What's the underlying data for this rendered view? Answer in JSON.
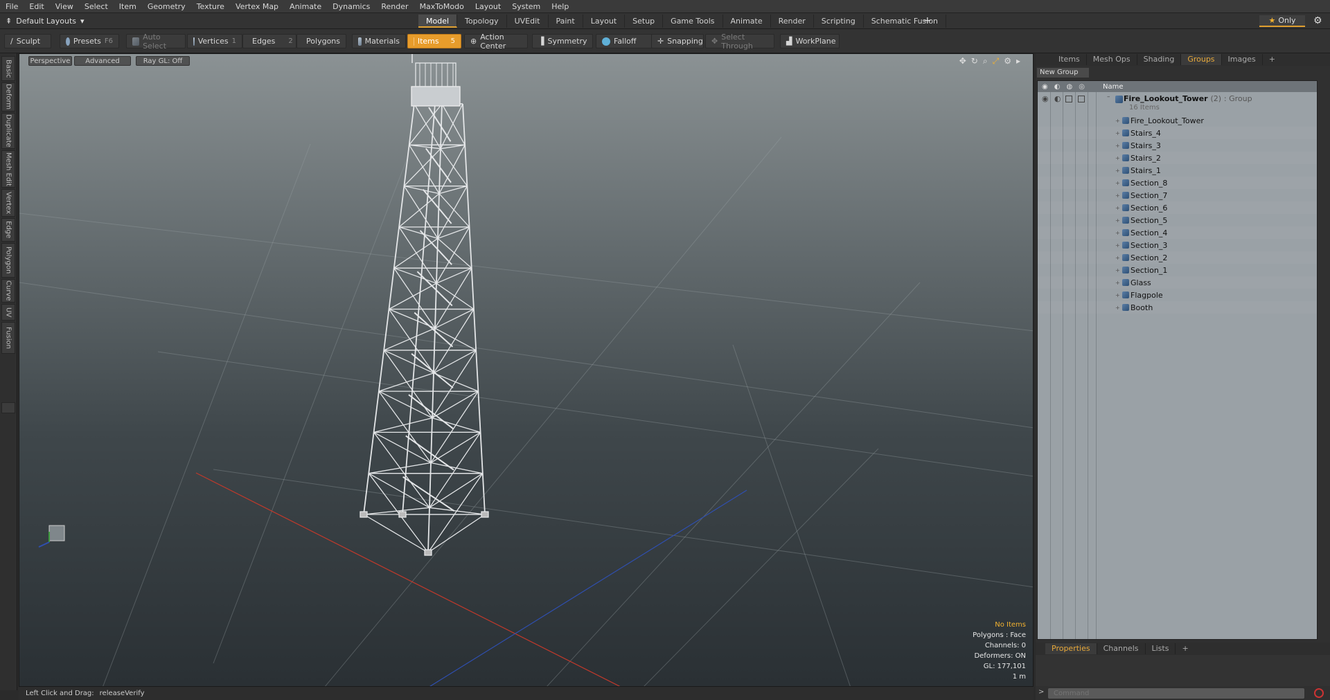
{
  "menu": [
    "File",
    "Edit",
    "View",
    "Select",
    "Item",
    "Geometry",
    "Texture",
    "Vertex Map",
    "Animate",
    "Dynamics",
    "Render",
    "MaxToModo",
    "Layout",
    "System",
    "Help"
  ],
  "layout_selector": "Default Layouts",
  "tabs": [
    {
      "label": "Model",
      "active": true
    },
    {
      "label": "Topology"
    },
    {
      "label": "UVEdit"
    },
    {
      "label": "Paint"
    },
    {
      "label": "Layout"
    },
    {
      "label": "Setup"
    },
    {
      "label": "Game Tools"
    },
    {
      "label": "Animate"
    },
    {
      "label": "Render"
    },
    {
      "label": "Scripting"
    },
    {
      "label": "Schematic Fusion"
    }
  ],
  "only_label": "Only",
  "toolbar": {
    "sculpt": "Sculpt",
    "presets": "Presets",
    "presets_key": "F6",
    "auto_select": "Auto Select",
    "vertices": "Vertices",
    "vertices_key": "1",
    "edges": "Edges",
    "edges_key": "2",
    "polygons": "Polygons",
    "materials": "Materials",
    "items": "Items",
    "items_key": "5",
    "action_center": "Action Center",
    "symmetry": "Symmetry",
    "falloff": "Falloff",
    "snapping": "Snapping",
    "select_through": "Select Through",
    "workplane": "WorkPlane"
  },
  "left_tabs": [
    "Basic",
    "Deform",
    "Duplicate",
    "Mesh Edit",
    "Vertex",
    "Edge",
    "Polygon",
    "Curve",
    "UV",
    "Fusion"
  ],
  "viewport": {
    "perspective": "Perspective",
    "advanced": "Advanced",
    "raygl": "Ray GL: Off",
    "stats": {
      "no_items": "No Items",
      "polygons": "Polygons : Face",
      "channels": "Channels: 0",
      "deformers": "Deformers: ON",
      "gl": "GL: 177,101",
      "scale": "1 m"
    }
  },
  "status": {
    "action": "Left Click and Drag:",
    "value": "releaseVerify"
  },
  "right_panel": {
    "tabs": [
      {
        "label": "Items"
      },
      {
        "label": "Mesh Ops"
      },
      {
        "label": "Shading"
      },
      {
        "label": "Groups",
        "active": true
      },
      {
        "label": "Images"
      }
    ],
    "new_group": "New Group",
    "column_name": "Name",
    "group": {
      "name": "Fire_Lookout_Tower",
      "count": "(2)",
      "type": ": Group",
      "sub": "16 Items"
    },
    "items": [
      "Fire_Lookout_Tower",
      "Stairs_4",
      "Stairs_3",
      "Stairs_2",
      "Stairs_1",
      "Section_8",
      "Section_7",
      "Section_6",
      "Section_5",
      "Section_4",
      "Section_3",
      "Section_2",
      "Section_1",
      "Glass",
      "Flagpole",
      "Booth"
    ],
    "bottom_tabs": [
      {
        "label": "Properties",
        "active": true
      },
      {
        "label": "Channels"
      },
      {
        "label": "Lists"
      }
    ],
    "command_placeholder": "Command"
  },
  "colors": {
    "accent": "#e79c2b",
    "axis_x": "#c0392b",
    "axis_z": "#2f4fb0"
  }
}
